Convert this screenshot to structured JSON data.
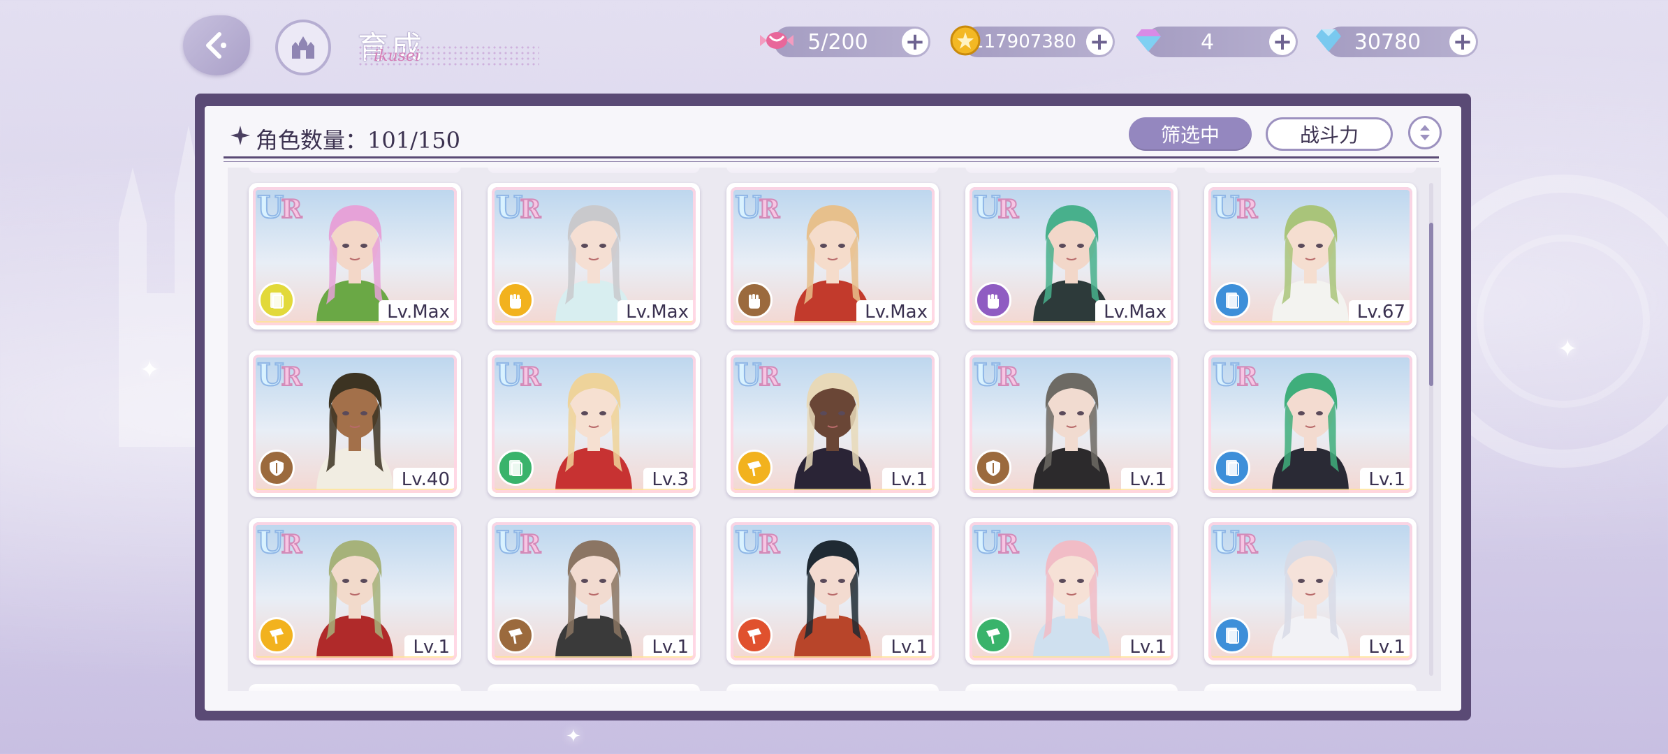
{
  "header": {
    "title": "育成",
    "title_script": "ikusei",
    "resources": [
      {
        "name": "candy",
        "value": "5/200",
        "color": "#e8679a"
      },
      {
        "name": "gold-coin",
        "value": "117907380",
        "color": "#f3b824"
      },
      {
        "name": "gem-pink",
        "value": "4",
        "color": "#d98be6"
      },
      {
        "name": "diamond",
        "value": "30780",
        "color": "#79c9ef"
      }
    ]
  },
  "panel": {
    "count_label": "角色数量：101/150",
    "filter_label": "筛选中",
    "sort_label": "战斗力"
  },
  "scroll_position": 0.12,
  "attribute_colors": {
    "yellow": "#e2d93a",
    "gold": "#f2b21e",
    "brown": "#9b6a3d",
    "purple": "#8f5cc2",
    "blue": "#3d8fd9",
    "green": "#39b36b",
    "red": "#e0512e"
  },
  "cards": [
    {
      "rarity": "UR",
      "level": "Lv.Max",
      "attr": "yellow",
      "attr_icon": "card-icon",
      "hair": "#e6a2d8",
      "skin": "#f3d7c8",
      "outfit": "#6aa845"
    },
    {
      "rarity": "UR",
      "level": "Lv.Max",
      "attr": "gold",
      "attr_icon": "fist-icon",
      "hair": "#c9c9cc",
      "skin": "#f5dfd3",
      "outfit": "#d8eef0"
    },
    {
      "rarity": "UR",
      "level": "Lv.Max",
      "attr": "brown",
      "attr_icon": "fist-icon",
      "hair": "#e7c08c",
      "skin": "#f5dccb",
      "outfit": "#c23a2c"
    },
    {
      "rarity": "UR",
      "level": "Lv.Max",
      "attr": "purple",
      "attr_icon": "fist-icon",
      "hair": "#48b08c",
      "skin": "#f2d7c9",
      "outfit": "#2d3a3a"
    },
    {
      "rarity": "UR",
      "level": "Lv.67",
      "attr": "blue",
      "attr_icon": "card-icon",
      "hair": "#a9c47a",
      "skin": "#f5ded0",
      "outfit": "#f3f3f0"
    },
    {
      "rarity": "UR",
      "level": "Lv.40",
      "attr": "brown",
      "attr_icon": "shield-icon",
      "hair": "#3c3322",
      "skin": "#a3704a",
      "outfit": "#f1ede2"
    },
    {
      "rarity": "UR",
      "level": "Lv.3",
      "attr": "green",
      "attr_icon": "card-icon",
      "hair": "#eed39a",
      "skin": "#f6e0d1",
      "outfit": "#c73232"
    },
    {
      "rarity": "UR",
      "level": "Lv.1",
      "attr": "gold",
      "attr_icon": "horn-icon",
      "hair": "#e8d9b8",
      "skin": "#6a4636",
      "outfit": "#2a2436"
    },
    {
      "rarity": "UR",
      "level": "Lv.1",
      "attr": "brown",
      "attr_icon": "shield-icon",
      "hair": "#6d6a64",
      "skin": "#f1dbd0",
      "outfit": "#2c2a2c"
    },
    {
      "rarity": "UR",
      "level": "Lv.1",
      "attr": "blue",
      "attr_icon": "card-icon",
      "hair": "#3fae7b",
      "skin": "#f3dbd0",
      "outfit": "#2a2a35"
    },
    {
      "rarity": "UR",
      "level": "Lv.1",
      "attr": "gold",
      "attr_icon": "horn-icon",
      "hair": "#a6b27a",
      "skin": "#f2dacb",
      "outfit": "#b02a2a"
    },
    {
      "rarity": "UR",
      "level": "Lv.1",
      "attr": "brown",
      "attr_icon": "horn-icon",
      "hair": "#8b7563",
      "skin": "#f2dbd0",
      "outfit": "#3a3a3a"
    },
    {
      "rarity": "UR",
      "level": "Lv.1",
      "attr": "red",
      "attr_icon": "horn-icon",
      "hair": "#1f2a33",
      "skin": "#f3dbd0",
      "outfit": "#b8452a"
    },
    {
      "rarity": "UR",
      "level": "Lv.1",
      "attr": "green",
      "attr_icon": "horn-icon",
      "hair": "#f1bcc6",
      "skin": "#f6e1d6",
      "outfit": "#cfe0ef"
    },
    {
      "rarity": "UR",
      "level": "Lv.1",
      "attr": "blue",
      "attr_icon": "card-icon",
      "hair": "#d8dbe6",
      "skin": "#f5e2da",
      "outfit": "#f2f2f6"
    }
  ]
}
